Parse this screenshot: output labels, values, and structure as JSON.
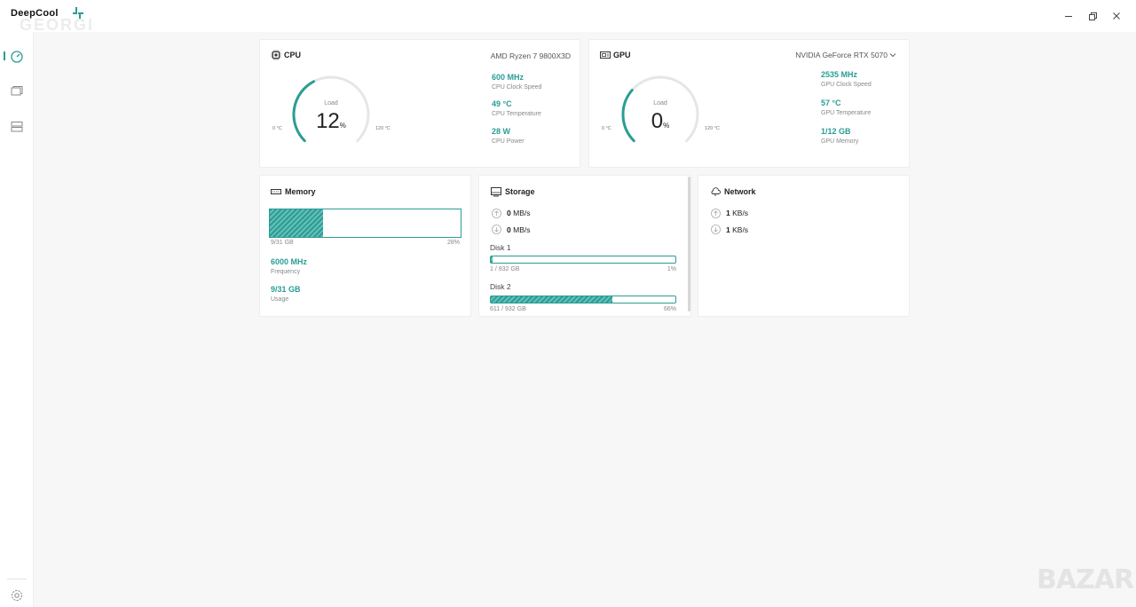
{
  "app": {
    "logo_text": "DeepCool",
    "watermark": "GEORGI",
    "window_controls": [
      "minimize-icon",
      "restore-icon",
      "close-icon"
    ]
  },
  "sidebar": {
    "items": [
      {
        "icon": "dashboard-gauge-icon",
        "active": true
      },
      {
        "icon": "devices-icon",
        "active": false
      },
      {
        "icon": "server-list-icon",
        "active": false
      }
    ],
    "bottom": {
      "icon": "settings-gear-icon"
    }
  },
  "cpu": {
    "title": "CPU",
    "model": "AMD Ryzen 7 9800X3D",
    "gauge": {
      "label": "Load",
      "value": "12",
      "unit": "%",
      "min": "0 °C",
      "max": "120 °C",
      "fraction": 0.12
    },
    "stats": [
      {
        "value": "600 MHz",
        "label": "CPU Clock Speed"
      },
      {
        "value": "49 °C",
        "label": "CPU Temperature"
      },
      {
        "value": "28 W",
        "label": "CPU Power"
      }
    ]
  },
  "gpu": {
    "title": "GPU",
    "model": "NVIDIA GeForce RTX 5070",
    "gauge": {
      "label": "Load",
      "value": "0",
      "unit": "%",
      "min": "0 °C",
      "max": "120 °C",
      "fraction": 0.0
    },
    "stats": [
      {
        "value": "2535 MHz",
        "label": "GPU Clock Speed"
      },
      {
        "value": "57 °C",
        "label": "GPU Temperature"
      },
      {
        "value": "1/12 GB",
        "label": "GPU Memory"
      }
    ]
  },
  "memory": {
    "title": "Memory",
    "bar_left": "9/31 GB",
    "bar_right": "28%",
    "fraction": 0.28,
    "stats": [
      {
        "value": "6000 MHz",
        "label": "Frequency"
      },
      {
        "value": "9/31 GB",
        "label": "Usage"
      }
    ]
  },
  "storage": {
    "title": "Storage",
    "upload": {
      "value": "0",
      "unit": "MB/s"
    },
    "download": {
      "value": "0",
      "unit": "MB/s"
    },
    "disks": [
      {
        "name": "Disk 1",
        "used": "1 / 932 GB",
        "percent": "1%",
        "fraction": 0.01
      },
      {
        "name": "Disk 2",
        "used": "611 / 932 GB",
        "percent": "66%",
        "fraction": 0.66
      }
    ]
  },
  "network": {
    "title": "Network",
    "upload": {
      "value": "1",
      "unit": "KB/s"
    },
    "download": {
      "value": "1",
      "unit": "KB/s"
    }
  },
  "watermark_bottom": "BAZAR",
  "colors": {
    "accent": "#2a9d94",
    "gauge_track": "#e6e6e6",
    "background": "#f7f7f7"
  }
}
